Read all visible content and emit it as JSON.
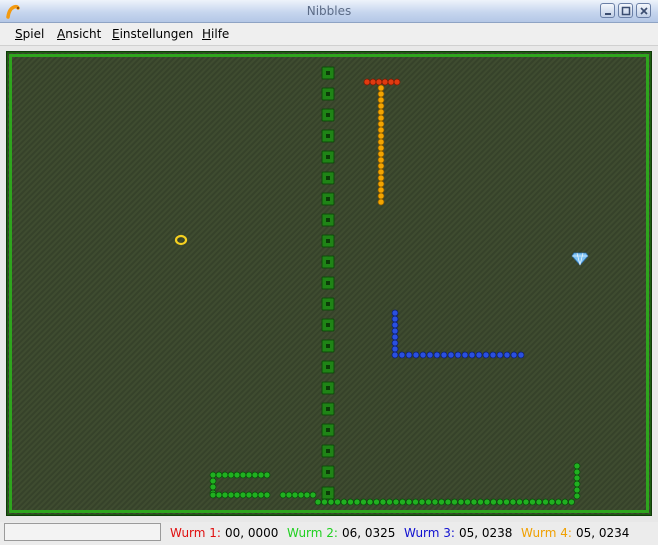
{
  "window": {
    "title": "Nibbles"
  },
  "menu": [
    {
      "mnemonic": "S",
      "rest": "piel"
    },
    {
      "mnemonic": "A",
      "rest": "nsicht"
    },
    {
      "mnemonic": "E",
      "rest": "instellungen"
    },
    {
      "mnemonic": "H",
      "rest": "ilfe"
    }
  ],
  "scores": [
    {
      "label": "Wurm 1:",
      "value": "00, 0000",
      "color": "#e01010"
    },
    {
      "label": "Wurm 2:",
      "value": "06, 0325",
      "color": "#20d020"
    },
    {
      "label": "Wurm 3:",
      "value": "05, 0238",
      "color": "#1010d0"
    },
    {
      "label": "Wurm 4:",
      "value": "05, 0234",
      "color": "#f0a000"
    }
  ],
  "colors": {
    "board_background": "#3f4c30",
    "border": "#2ea51d",
    "wall": "#2ea51d",
    "worm_red": "#e03a10",
    "worm_green": "#20b020",
    "worm_blue": "#2a50e0",
    "worm_orange": "#f2a400"
  },
  "icons": {
    "app": "nibbles-worm-icon",
    "bonus_ring": "gold-ring-icon",
    "bonus_diamond": "diamond-icon"
  }
}
